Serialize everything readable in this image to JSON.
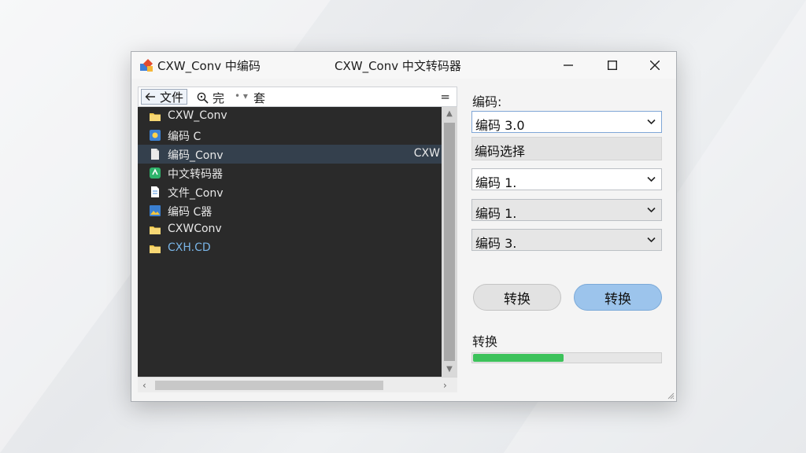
{
  "window": {
    "title_left": "CXW_Conv 中编码",
    "title_center": "CXW_Conv 中文转码器"
  },
  "toolbar": {
    "back_label": "文件",
    "zoom_label": "完",
    "dots": "• ▾",
    "third_label": "套",
    "menu_glyph": "="
  },
  "files": [
    {
      "name": "CXW_Conv",
      "icon": "folder-icon",
      "right": ""
    },
    {
      "name": "编码 C",
      "icon": "network-icon",
      "right": ""
    },
    {
      "name": "编码_Conv",
      "icon": "document-icon",
      "right": "CXW",
      "selected": true
    },
    {
      "name": "中文转码器",
      "icon": "app-icon",
      "right": ""
    },
    {
      "name": "文件_Conv",
      "icon": "text-file-icon",
      "right": ""
    },
    {
      "name": "编码 C器",
      "icon": "image-file-icon",
      "right": ""
    },
    {
      "name": "CXWConv",
      "icon": "folder-icon",
      "right": ""
    },
    {
      "name": "CXH.CD",
      "icon": "folder-icon",
      "right": "",
      "blue": true
    }
  ],
  "right_pane": {
    "encoding_label": "编码:",
    "encoding_value": "编码 3.0",
    "band_label": "编码选择",
    "select1_value": "编码 1.",
    "select2_value": "编码 1.",
    "select3_value": "编码 3.",
    "button_left": "转换",
    "button_right": "转换",
    "progress_label": "转换",
    "progress_fraction": 0.48
  },
  "colors": {
    "accent_blue": "#9cc4ec",
    "progress_green": "#3cc25a",
    "list_bg": "#2a2a2a",
    "selected_row": "#34404d"
  }
}
